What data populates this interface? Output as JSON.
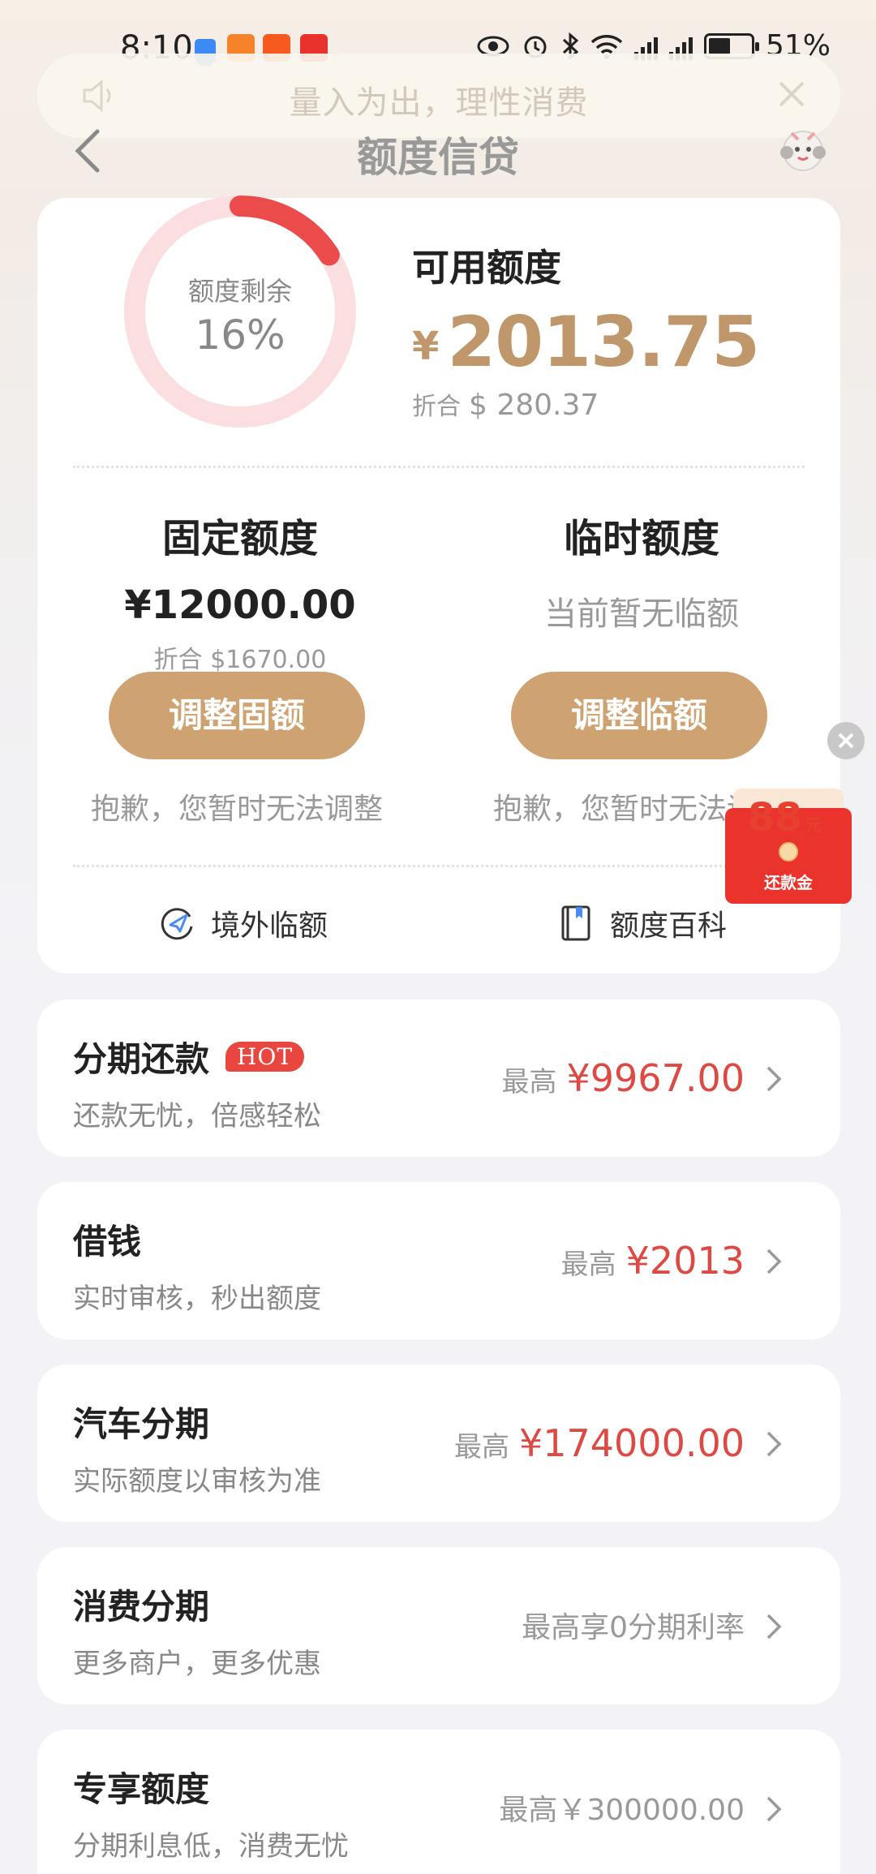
{
  "status_bar": {
    "time": "8:10",
    "battery": "51%",
    "network": "4G"
  },
  "notice": {
    "text": "量入为出，理性消费"
  },
  "header": {
    "title": "额度信贷"
  },
  "summary": {
    "ring_label": "额度剩余",
    "ring_percent": "16%",
    "ring_fraction": 0.16,
    "available_label": "可用额度",
    "currency": "¥",
    "available_amount": "2013.75",
    "conv_prefix": "折合",
    "conv_amount": "$ 280.37"
  },
  "fixed": {
    "title": "固定额度",
    "amount": "¥12000.00",
    "conv": "折合 $1670.00",
    "button": "调整固额",
    "note": "抱歉，您暂时无法调整"
  },
  "temp": {
    "title": "临时额度",
    "none_text": "当前暂无临额",
    "button": "调整临额",
    "note": "抱歉，您暂时无法调整"
  },
  "links": {
    "overseas": "境外临额",
    "wiki": "额度百科"
  },
  "red_packet": {
    "amount": "88",
    "unit": "元",
    "label": "还款金"
  },
  "products": [
    {
      "title": "分期还款",
      "badge": "HOT",
      "subtitle": "还款无忧，倍感轻松",
      "prefix": "最高",
      "value": "¥9967.00",
      "value_style": "red"
    },
    {
      "title": "借钱",
      "badge": "",
      "subtitle": "实时审核，秒出额度",
      "prefix": "最高",
      "value": "¥2013",
      "value_style": "red"
    },
    {
      "title": "汽车分期",
      "badge": "",
      "subtitle": "实际额度以审核为准",
      "prefix": "最高",
      "value": "¥174000.00",
      "value_style": "red"
    },
    {
      "title": "消费分期",
      "badge": "",
      "subtitle": "更多商户，更多优惠",
      "prefix": "",
      "value": "最高享0分期利率",
      "value_style": "gray"
    },
    {
      "title": "专享额度",
      "badge": "",
      "subtitle": "分期利息低，消费无忧",
      "prefix": "",
      "value": "最高￥300000.00",
      "value_style": "gray"
    }
  ],
  "colors": {
    "accent_gold": "#cfa271",
    "amount_gold": "#c0976a",
    "red": "#dd4a44",
    "ring_track": "#fbdfe0",
    "ring_fill": "#ec4b4b"
  }
}
